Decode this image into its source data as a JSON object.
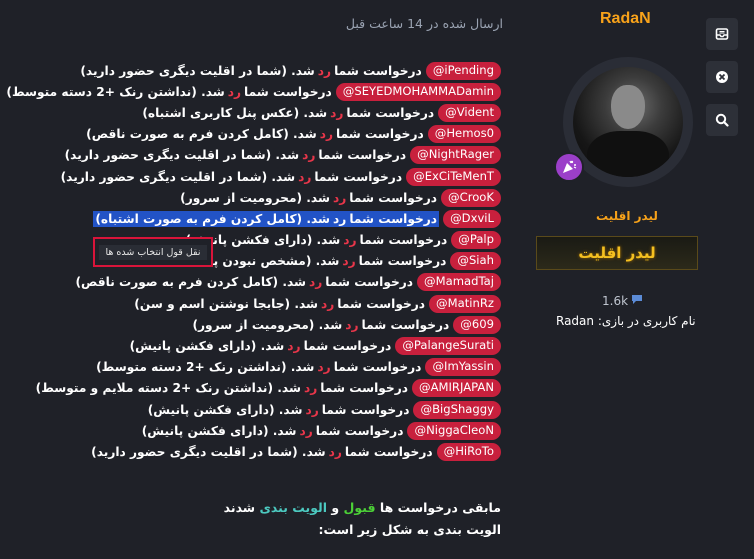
{
  "post": {
    "time": "ارسال شده در 14 ساعت قبل",
    "lines": [
      {
        "mention": "iPending@",
        "text_before": "درخواست شما",
        "rejected": "رد",
        "text_after": "شد. (شما در اقلیت دیگری حضور دارید)"
      },
      {
        "mention": "SEYEDMOHAMMADamin@",
        "text_before": "درخواست شما",
        "rejected": "رد",
        "text_after": "شد. (نداشتن رنک +2 دسته متوسط)"
      },
      {
        "mention": "Vident@",
        "text_before": "درخواست شما",
        "rejected": "رد",
        "text_after": "شد. (عکس پنل کاربری اشتباه)"
      },
      {
        "mention": "Hemos0@",
        "text_before": "درخواست شما",
        "rejected": "رد",
        "text_after": "شد. (کامل کردن فرم به صورت ناقص)"
      },
      {
        "mention": "NightRager@",
        "text_before": "درخواست شما",
        "rejected": "رد",
        "text_after": "شد. (شما در اقلیت دیگری حضور دارید)"
      },
      {
        "mention": "ExCiTeMenT@",
        "text_before": "درخواست شما",
        "rejected": "رد",
        "text_after": "شد. (شما در اقلیت دیگری حضور دارید)"
      },
      {
        "mention": "CrooK@",
        "text_before": "درخواست شما",
        "rejected": "رد",
        "text_after": "شد. (محرومیت از سرور)"
      },
      {
        "mention": "DxviL@",
        "text_before": "درخواست شما",
        "rejected": "رد",
        "text_after": "شد. (کامل کردن فرم به صورت اشتباه)"
      },
      {
        "mention": "Palp@",
        "text_before": "درخواست شما",
        "rejected": "رد",
        "text_after": "شد. (دارای فکشن پانیش)"
      },
      {
        "mention": "Siah@",
        "text_before": "درخواست شما",
        "rejected": "رد",
        "text_after": "شد. (مشخص نبودن پنل کا"
      },
      {
        "mention": "MamadTaj@",
        "text_before": "درخواست شما",
        "rejected": "رد",
        "text_after": "شد. (کامل کردن فرم به صورت ناقص)"
      },
      {
        "mention": "MatinRz@",
        "text_before": "درخواست شما",
        "rejected": "رد",
        "text_after": "شد. (جابجا نوشتن اسم و سن)"
      },
      {
        "mention": "609@",
        "text_before": "درخواست شما",
        "rejected": "رد",
        "text_after": "شد. (محرومیت از سرور)"
      },
      {
        "mention": "PalangeSurati@",
        "text_before": "درخواست شما",
        "rejected": "رد",
        "text_after": "شد. (دارای فکشن پانیش)"
      },
      {
        "mention": "ImYassin@",
        "text_before": "درخواست شما",
        "rejected": "رد",
        "text_after": "شد. (نداشتن رنک +2 دسته متوسط)"
      },
      {
        "mention": "AMIRJAPAN@",
        "text_before": "درخواست شما",
        "rejected": "رد",
        "text_after": "شد. (نداشتن رنک +2 دسته ملایم و متوسط)"
      },
      {
        "mention": "BigShaggy@",
        "text_before": "درخواست شما",
        "rejected": "رد",
        "text_after": "شد. (دارای فکشن پانیش)"
      },
      {
        "mention": "NiggaCleoN@",
        "text_before": "درخواست شما",
        "rejected": "رد",
        "text_after": "شد. (دارای فکشن پانیش)"
      },
      {
        "mention": "HiRoTo@",
        "text_before": "درخواست شما",
        "rejected": "رد",
        "text_after": "شد. (شما در اقلیت دیگری حضور دارید)"
      }
    ],
    "highlighted_index": 7,
    "tooltip": "نقل قول انتخاب شده ها",
    "footer": {
      "part1": "مابقی درخواست ها",
      "accepted": "قبول",
      "and": "و",
      "priority": "الویت بندی",
      "part2": "شدند",
      "line2": "الویت بندی به شکل زیر است:"
    }
  },
  "user": {
    "name": "RadaN",
    "role": "لیدر اقلیت",
    "banner": "لیدر اقلیت",
    "message_count": "1.6k",
    "ingame_label": "نام کاربری در بازی:",
    "ingame_name": "Radan",
    "badge_icon": "party-popper-icon"
  },
  "side_buttons": [
    {
      "name": "inbox-icon"
    },
    {
      "name": "close-icon"
    },
    {
      "name": "search-icon"
    }
  ],
  "colors": {
    "background": "#1f2128",
    "mention": "#c8203d",
    "rejected": "#e8364a",
    "highlight": "#2253c6",
    "username": "#f7a21a",
    "accepted": "#4cd137",
    "priority": "#4cc9c0"
  }
}
